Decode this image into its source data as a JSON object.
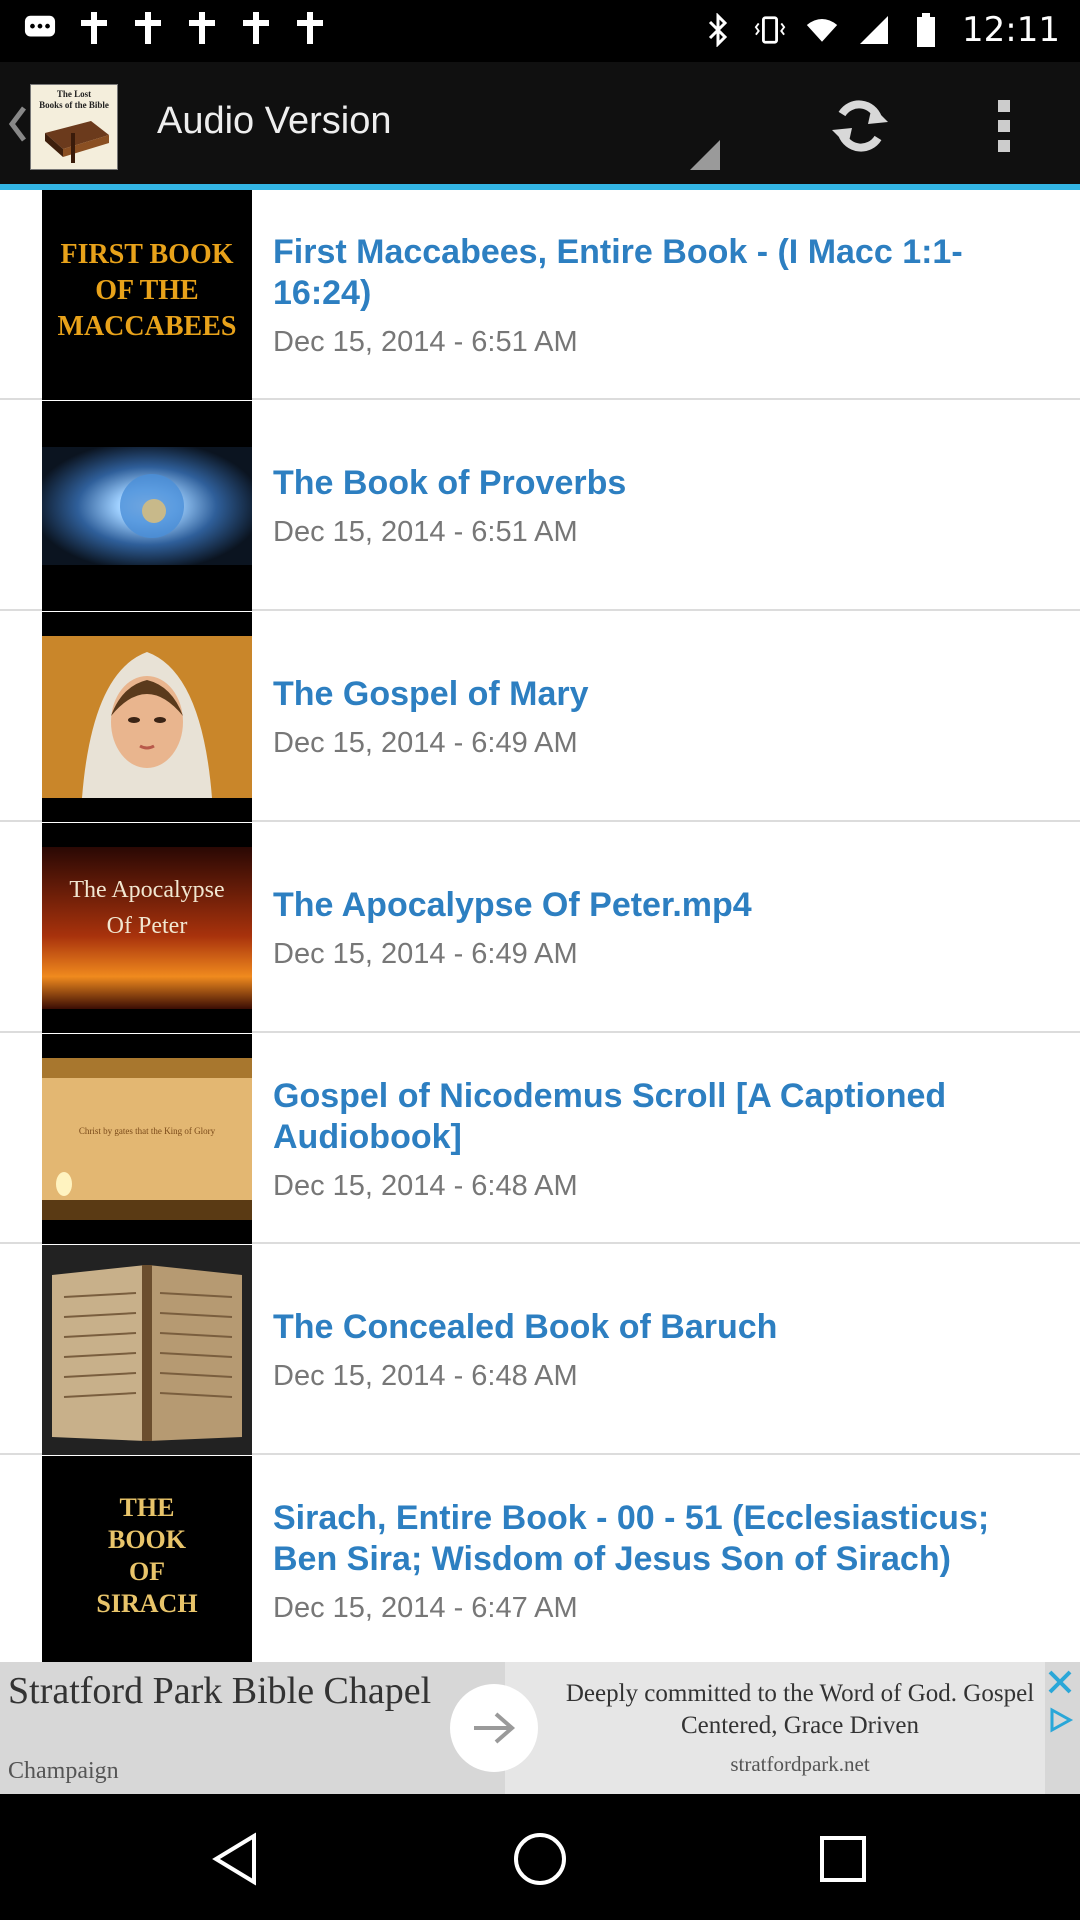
{
  "status_bar": {
    "time": "12:11",
    "left_icons": [
      "chat-bubble-icon",
      "app-icon",
      "app-icon",
      "app-icon",
      "app-icon",
      "app-icon"
    ],
    "right_icons": [
      "bluetooth-icon",
      "vibrate-icon",
      "wifi-icon",
      "signal-icon",
      "battery-icon"
    ]
  },
  "action_bar": {
    "title": "Audio Version",
    "app_icon_text": "The Lost Books of the Bible",
    "icons": [
      "back-chevron-icon",
      "spinner-triangle-icon",
      "refresh-icon",
      "overflow-menu-icon"
    ]
  },
  "items": [
    {
      "title": "First Maccabees, Entire Book - (I Macc 1:1-16:24)",
      "date": "Dec 15, 2014 - 6:51 AM",
      "thumb_text": "FIRST BOOK OF THE MACCABEES"
    },
    {
      "title": "The Book of Proverbs",
      "date": "Dec 15, 2014 - 6:51 AM",
      "thumb_text": ""
    },
    {
      "title": "The Gospel of Mary",
      "date": "Dec 15, 2014 - 6:49 AM",
      "thumb_text": ""
    },
    {
      "title": "The Apocalypse Of Peter.mp4",
      "date": "Dec 15, 2014 - 6:49 AM",
      "thumb_text": "The Apocalypse Of Peter"
    },
    {
      "title": "Gospel of Nicodemus Scroll [A Captioned Audiobook]",
      "date": "Dec 15, 2014 - 6:48 AM",
      "thumb_text": ""
    },
    {
      "title": "The Concealed Book of Baruch",
      "date": "Dec 15, 2014 - 6:48 AM",
      "thumb_text": ""
    },
    {
      "title": "Sirach, Entire Book - 00 - 51 (Ecclesiasticus; Ben Sira; Wisdom of Jesus Son of Sirach)",
      "date": "Dec 15, 2014 - 6:47 AM",
      "thumb_text": "THE BOOK OF SIRACH"
    }
  ],
  "ad": {
    "left_title": "Stratford Park Bible Chapel",
    "left_sub": "Champaign",
    "right_text": "Deeply committed to the Word of God. Gospel Centered, Grace Driven",
    "right_url": "stratfordpark.net"
  },
  "nav_bar": {
    "icons": [
      "back-triangle-icon",
      "home-circle-icon",
      "recents-square-icon"
    ]
  },
  "colors": {
    "accent": "#33b5e5",
    "title_blue": "#2d7fc1",
    "date_gray": "#777777"
  }
}
